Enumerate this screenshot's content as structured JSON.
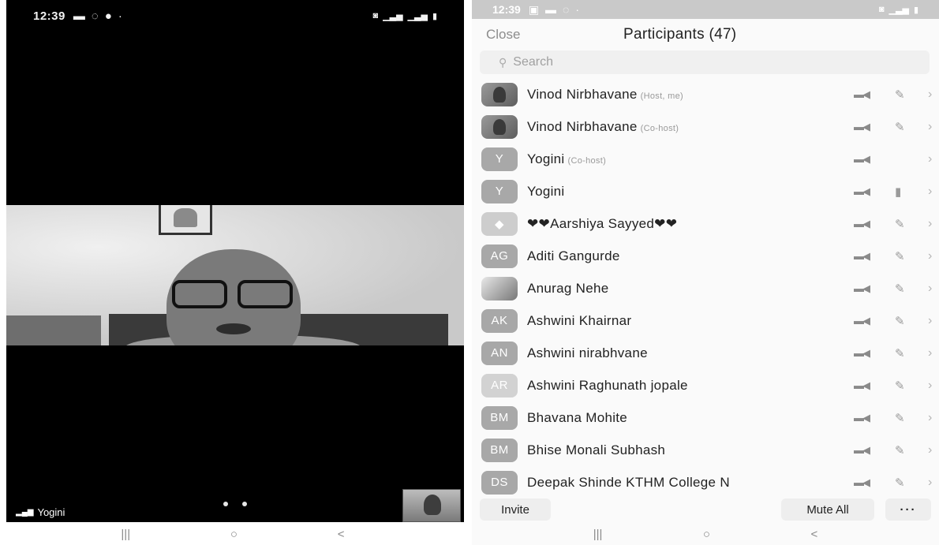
{
  "left_phone": {
    "status_bar": {
      "time": "12:39"
    },
    "self_name": "Yogini"
  },
  "right_phone": {
    "status_bar": {
      "time": "12:39"
    },
    "header": {
      "close_label": "Close",
      "title": "Participants (47)"
    },
    "search": {
      "placeholder": "Search"
    },
    "participants": [
      {
        "avatar": "",
        "name": "Vinod Nirbhavane",
        "role": "(Host, me)",
        "mic_icon": "mic-muted-icon"
      },
      {
        "avatar": "",
        "name": "Vinod Nirbhavane",
        "role": "(Co-host)",
        "mic_icon": "mic-muted-icon"
      },
      {
        "avatar": "Y",
        "name": "Yogini",
        "role": "(Co-host)",
        "mic_icon": ""
      },
      {
        "avatar": "Y",
        "name": "Yogini",
        "role": "",
        "mic_icon": "mic-icon"
      },
      {
        "avatar": "",
        "name": "❤❤Aarshiya Sayyed❤❤",
        "role": "",
        "mic_icon": "mic-muted-icon"
      },
      {
        "avatar": "AG",
        "name": "Aditi Gangurde",
        "role": "",
        "mic_icon": "mic-muted-icon"
      },
      {
        "avatar": "",
        "name": "Anurag Nehe",
        "role": "",
        "mic_icon": "mic-muted-icon"
      },
      {
        "avatar": "AK",
        "name": "Ashwini Khairnar",
        "role": "",
        "mic_icon": "mic-muted-icon"
      },
      {
        "avatar": "AN",
        "name": "Ashwini nirabhvane",
        "role": "",
        "mic_icon": "mic-muted-icon"
      },
      {
        "avatar": "AR",
        "name": "Ashwini Raghunath jopale",
        "role": "",
        "mic_icon": "mic-muted-icon"
      },
      {
        "avatar": "BM",
        "name": "Bhavana Mohite",
        "role": "",
        "mic_icon": "mic-muted-icon"
      },
      {
        "avatar": "BM",
        "name": "Bhise Monali Subhash",
        "role": "",
        "mic_icon": "mic-muted-icon"
      },
      {
        "avatar": "DS",
        "name": "Deepak Shinde KTHM College N",
        "role": "",
        "mic_icon": "mic-muted-icon"
      }
    ],
    "bottom_bar": {
      "invite_label": "Invite",
      "mute_all_label": "Mute All",
      "more_label": "···"
    }
  },
  "nav_icons": {
    "recents": "|||",
    "home": "○",
    "back": "<"
  }
}
